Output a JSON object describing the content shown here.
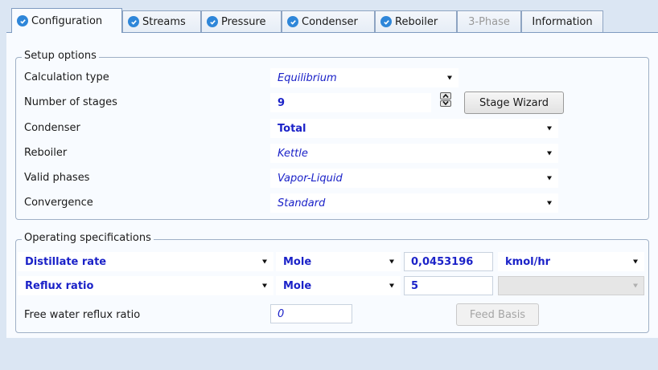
{
  "tabs": [
    {
      "label": "Configuration",
      "status_icon": "check-circle-icon",
      "active": true
    },
    {
      "label": "Streams",
      "status_icon": "check-circle-icon"
    },
    {
      "label": "Pressure",
      "status_icon": "check-circle-icon"
    },
    {
      "label": "Condenser",
      "status_icon": "check-circle-icon"
    },
    {
      "label": "Reboiler",
      "status_icon": "check-circle-icon"
    },
    {
      "label": "3-Phase",
      "disabled": true
    },
    {
      "label": "Information"
    }
  ],
  "setup": {
    "legend": "Setup options",
    "calculation_type": {
      "label": "Calculation type",
      "value": "Equilibrium"
    },
    "number_of_stages": {
      "label": "Number of stages",
      "value": "9"
    },
    "stage_wizard_label": "Stage Wizard",
    "condenser": {
      "label": "Condenser",
      "value": "Total"
    },
    "reboiler": {
      "label": "Reboiler",
      "value": "Kettle"
    },
    "valid_phases": {
      "label": "Valid phases",
      "value": "Vapor-Liquid"
    },
    "convergence": {
      "label": "Convergence",
      "value": "Standard"
    }
  },
  "operating": {
    "legend": "Operating specifications",
    "rows": [
      {
        "spec": "Distillate rate",
        "basis": "Mole",
        "value": "0,0453196",
        "units": "kmol/hr"
      },
      {
        "spec": "Reflux ratio",
        "basis": "Mole",
        "value": "5",
        "units": ""
      }
    ],
    "free_water_label": "Free water reflux ratio",
    "free_water_value": "0",
    "feed_basis_label": "Feed Basis"
  },
  "colors": {
    "accent_text": "#1b22c8",
    "check_icon": "#2e86d9",
    "background": "#dbe6f3"
  }
}
